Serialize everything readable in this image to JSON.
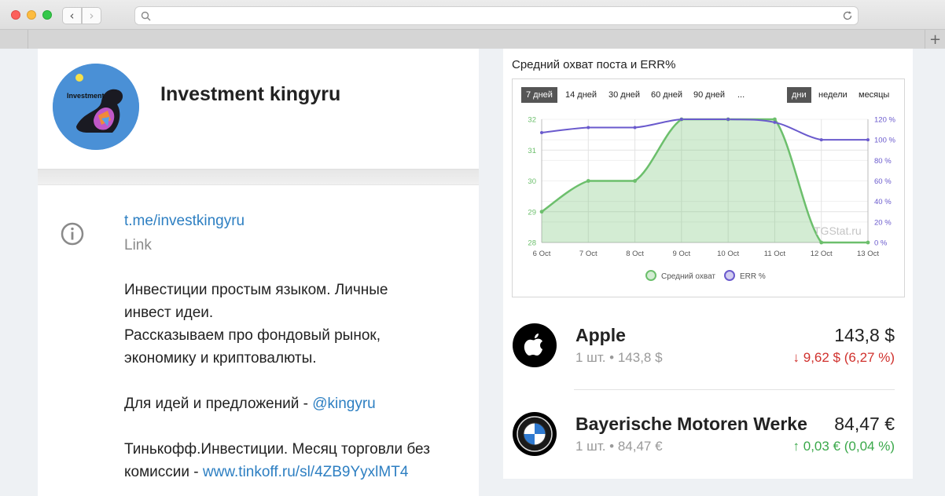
{
  "browser": {
    "back_glyph": "‹",
    "forward_glyph": "›",
    "new_tab_glyph": "+",
    "icons": [
      "search-icon",
      "reload-icon"
    ]
  },
  "channel": {
    "name": "Investment kingyru",
    "avatar_text": "Investment",
    "link": "t.me/investkingyru",
    "link_label": "Link",
    "desc_line1": "Инвестиции простым языком. Личные",
    "desc_line2": "инвест идеи.",
    "desc_line3": "Рассказываем про фондовый рынок,",
    "desc_line4": "экономику и криптовалюты.",
    "ideas_text": "Для идей и предложений - ",
    "ideas_link": "@kingyru",
    "tinkoff_line1": "Тинькофф.Инвестиции. Месяц торговли без",
    "tinkoff_text": "комиссии - ",
    "tinkoff_link": "www.tinkoff.ru/sl/4ZB9YyxlMT4"
  },
  "chart_panel": {
    "title": "Средний охват поста и ERR%",
    "periods": [
      "7 дней",
      "14 дней",
      "30 дней",
      "60 дней",
      "90 дней",
      "..."
    ],
    "active_period": "7 дней",
    "granularity": [
      "дни",
      "недели",
      "месяцы"
    ],
    "active_granularity": "дни",
    "watermark": "TGStat.ru"
  },
  "chart_data": {
    "type": "area",
    "title": "Средний охват поста и ERR%",
    "categories": [
      "6 Oct",
      "7 Oct",
      "8 Oct",
      "9 Oct",
      "10 Oct",
      "11 Oct",
      "12 Oct",
      "13 Oct"
    ],
    "series": [
      {
        "name": "Средний охват",
        "axis": "left",
        "values": [
          29,
          30,
          30,
          32,
          32,
          32,
          28,
          28
        ],
        "color": "#6cbf6c"
      },
      {
        "name": "ERR %",
        "axis": "right",
        "values": [
          107,
          112,
          112,
          120,
          120,
          117,
          100,
          100
        ],
        "color": "#6a5acd"
      }
    ],
    "y_left": {
      "ticks": [
        "28",
        "29",
        "30",
        "31",
        "32"
      ],
      "ylim": [
        28,
        32
      ]
    },
    "y_right": {
      "ticks": [
        "0 %",
        "20 %",
        "40 %",
        "60 %",
        "80 %",
        "100 %",
        "120 %"
      ],
      "ylim": [
        0,
        120
      ]
    },
    "grid": true,
    "legend": "bottom"
  },
  "stocks": [
    {
      "name": "Apple",
      "qty": "1 шт. • 143,8 $",
      "price": "143,8 $",
      "change": "9,62 $ (6,27 %)",
      "direction": "down",
      "logo": "apple-icon"
    },
    {
      "name": "Bayerische Motoren Werke",
      "qty": "1 шт. • 84,47 €",
      "price": "84,47 €",
      "change": "0,03 € (0,04 %)",
      "direction": "up",
      "logo": "bmw-icon"
    }
  ],
  "arrows": {
    "down": "↓",
    "up": "↑"
  }
}
